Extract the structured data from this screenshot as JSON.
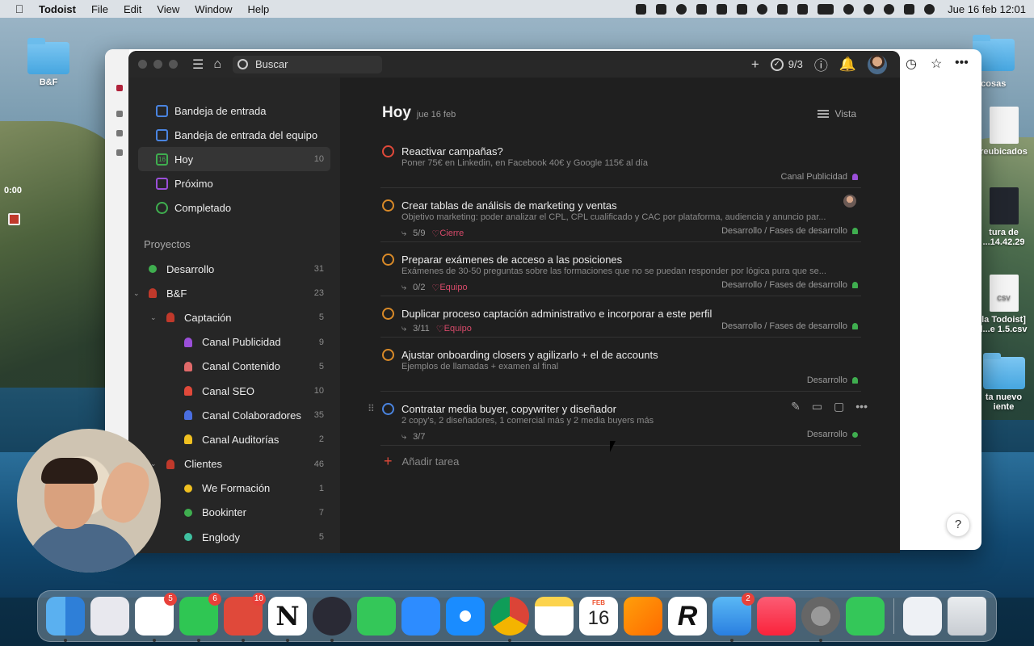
{
  "menubar": {
    "app": "Todoist",
    "menus": [
      "File",
      "Edit",
      "View",
      "Window",
      "Help"
    ],
    "clock": "Jue 16 feb  12:01"
  },
  "desktop": {
    "left_folder_label": "B&F",
    "right_labels": [
      "s cosas",
      "reubicados",
      "tura de",
      "...14.42.29",
      "la Todoist]",
      "l...e 1.5.csv",
      "ta nuevo",
      "iente"
    ],
    "csv_label": "CSV"
  },
  "screen_recorder": {
    "timer": "0:00"
  },
  "topbar": {
    "search_placeholder": "Buscar",
    "karma": "9/3"
  },
  "sidebar": {
    "nav": [
      {
        "label": "Bandeja de entrada",
        "count": ""
      },
      {
        "label": "Bandeja de entrada del equipo",
        "count": ""
      },
      {
        "label": "Hoy",
        "count": "10"
      },
      {
        "label": "Próximo",
        "count": ""
      },
      {
        "label": "Completado",
        "count": ""
      }
    ],
    "projects_heading": "Proyectos",
    "projects": [
      {
        "label": "Desarrollo",
        "count": "31"
      },
      {
        "label": "B&F",
        "count": "23"
      },
      {
        "label": "Captación",
        "count": "5"
      },
      {
        "label": "Canal Publicidad",
        "count": "9"
      },
      {
        "label": "Canal Contenido",
        "count": "5"
      },
      {
        "label": "Canal SEO",
        "count": "10"
      },
      {
        "label": "Canal Colaboradores",
        "count": "35"
      },
      {
        "label": "Canal Auditorías",
        "count": "2"
      },
      {
        "label": "Clientes",
        "count": "46"
      },
      {
        "label": "We Formación",
        "count": "1"
      },
      {
        "label": "Bookinter",
        "count": "7"
      },
      {
        "label": "Englody",
        "count": "5"
      }
    ]
  },
  "main": {
    "title": "Hoy",
    "date": "jue 16 feb",
    "view_label": "Vista",
    "add_task": "Añadir tarea",
    "tasks": [
      {
        "title": "Reactivar campañas?",
        "desc": "Poner 75€ en Linkedin, en Facebook 40€ y Google 115€ al día",
        "subtasks": "",
        "label": "",
        "project": "Canal Publicidad"
      },
      {
        "title": "Crear tablas de análisis de marketing y ventas",
        "desc": "Objetivo marketing: poder analizar el CPL, CPL cualificado y CAC por plataforma, audiencia y anuncio par...",
        "subtasks": "5/9",
        "label": "Cierre",
        "project": "Desarrollo / Fases de desarrollo"
      },
      {
        "title": "Preparar exámenes de acceso a las posiciones",
        "desc": "Exámenes de 30-50 preguntas sobre las formaciones que no se puedan responder por lógica pura que se...",
        "subtasks": "0/2",
        "label": "Equipo",
        "project": "Desarrollo / Fases de desarrollo"
      },
      {
        "title": "Duplicar proceso captación administrativo e incorporar a este perfil",
        "desc": "",
        "subtasks": "3/11",
        "label": "Equipo",
        "project": "Desarrollo / Fases de desarrollo"
      },
      {
        "title": "Ajustar onboarding closers y agilizarlo + el de accounts",
        "desc": "Ejemplos de llamadas + examen al final",
        "subtasks": "",
        "label": "",
        "project": "Desarrollo"
      },
      {
        "title": "Contratar media buyer, copywriter y diseñador",
        "desc": "2 copy's, 2 diseñadores, 1 comercial más y 2 media buyers más",
        "subtasks": "3/7",
        "label": "",
        "project": "Desarrollo"
      }
    ]
  },
  "dock": {
    "calendar_month": "FEB",
    "calendar_day": "16",
    "badges": {
      "slack": "5",
      "whatsapp": "6",
      "todoist": "10",
      "mail": "2"
    },
    "notion_glyph": "N",
    "reeder_glyph": "R"
  },
  "help_glyph": "?",
  "colors": {
    "accent_red": "#e0493a",
    "priority_orange": "#d98a28",
    "label_pink": "#d84a6a",
    "project_green": "#3fae4f",
    "project_purple": "#9b4fd9"
  }
}
